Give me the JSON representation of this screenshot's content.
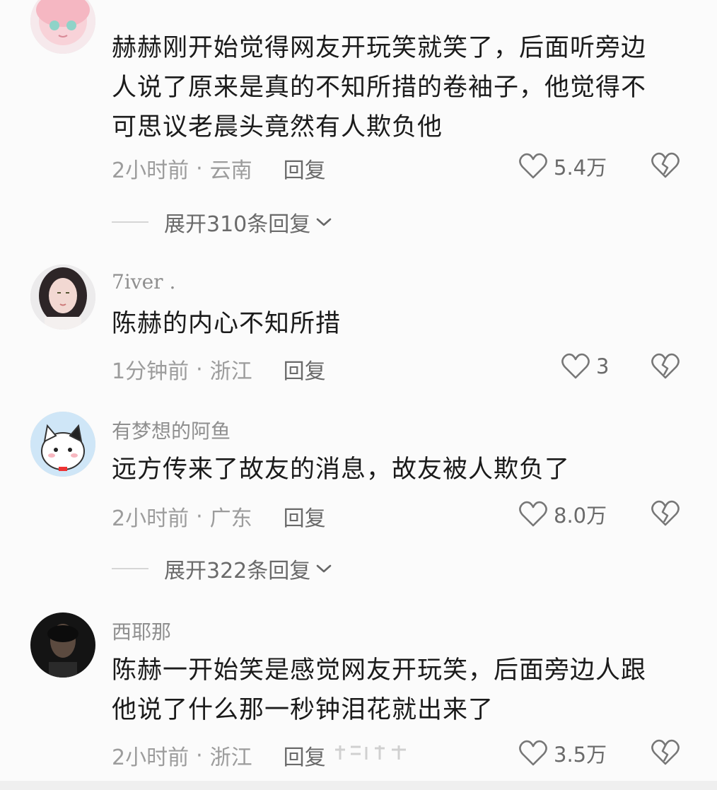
{
  "comments": [
    {
      "username": "",
      "lines": [
        "赫赫刚开始觉得网友开玩笑就笑了，后面听旁边",
        "人说了原来是真的不知所措的卷袖子，他觉得不",
        "可思议老晨头竟然有人欺负他"
      ],
      "time": "2小时前",
      "location": "云南",
      "reply_label": "回复",
      "likes": "5.4万",
      "expand_label": "展开310条回复"
    },
    {
      "username": "7iver .",
      "lines": [
        "陈赫的内心不知所措"
      ],
      "time": "1分钟前",
      "location": "浙江",
      "reply_label": "回复",
      "likes": "3"
    },
    {
      "username": "有梦想的阿鱼",
      "lines": [
        "远方传来了故友的消息，故友被人欺负了"
      ],
      "time": "2小时前",
      "location": "广东",
      "reply_label": "回复",
      "likes": "8.0万",
      "expand_label": "展开322条回复"
    },
    {
      "username": "西耶那",
      "lines": [
        "陈赫一开始笑是感觉网友开玩笑，后面旁边人跟",
        "他说了什么那一秒钟泪花就出来了"
      ],
      "time": "2小时前",
      "location": "浙江",
      "reply_label": "回复",
      "likes": "3.5万"
    }
  ],
  "separator": "·",
  "icons": {
    "like": "heart-outline-icon",
    "dislike": "broken-heart-icon",
    "expand": "chevron-down-icon"
  },
  "colors": {
    "background": "#fbfbfb",
    "text": "#1b1b1b",
    "meta": "#9c9c9c"
  }
}
